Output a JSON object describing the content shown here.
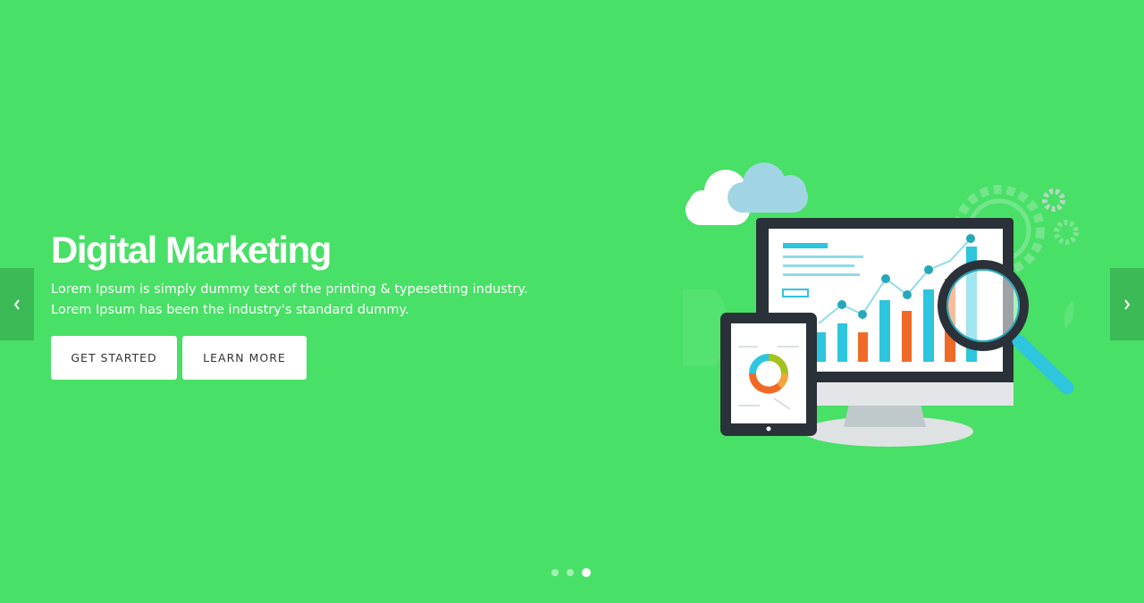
{
  "hero": {
    "title": "Digital Marketing",
    "description_line1": "Lorem Ipsum is simply dummy text of the printing & typesetting industry.",
    "description_line2": "Lorem Ipsum has been the industry's standard dummy.",
    "primary_button": "GET STARTED",
    "secondary_button": "LEARN MORE"
  },
  "carousel": {
    "prev_icon": "chevron-left-icon",
    "next_icon": "chevron-right-icon",
    "slide_count": 3,
    "active_slide": 3
  },
  "illustration": {
    "icons": [
      "cloud-icon",
      "gear-icon",
      "monitor-icon",
      "tablet-icon",
      "magnifier-icon",
      "bar-chart-icon",
      "donut-chart-icon"
    ]
  },
  "colors": {
    "background": "#48e066",
    "arrow_bg": "#3cba55",
    "button_bg": "#ffffff",
    "chart_blue": "#2ec5de",
    "chart_orange": "#f06a27",
    "device_dark": "#2a3139"
  }
}
